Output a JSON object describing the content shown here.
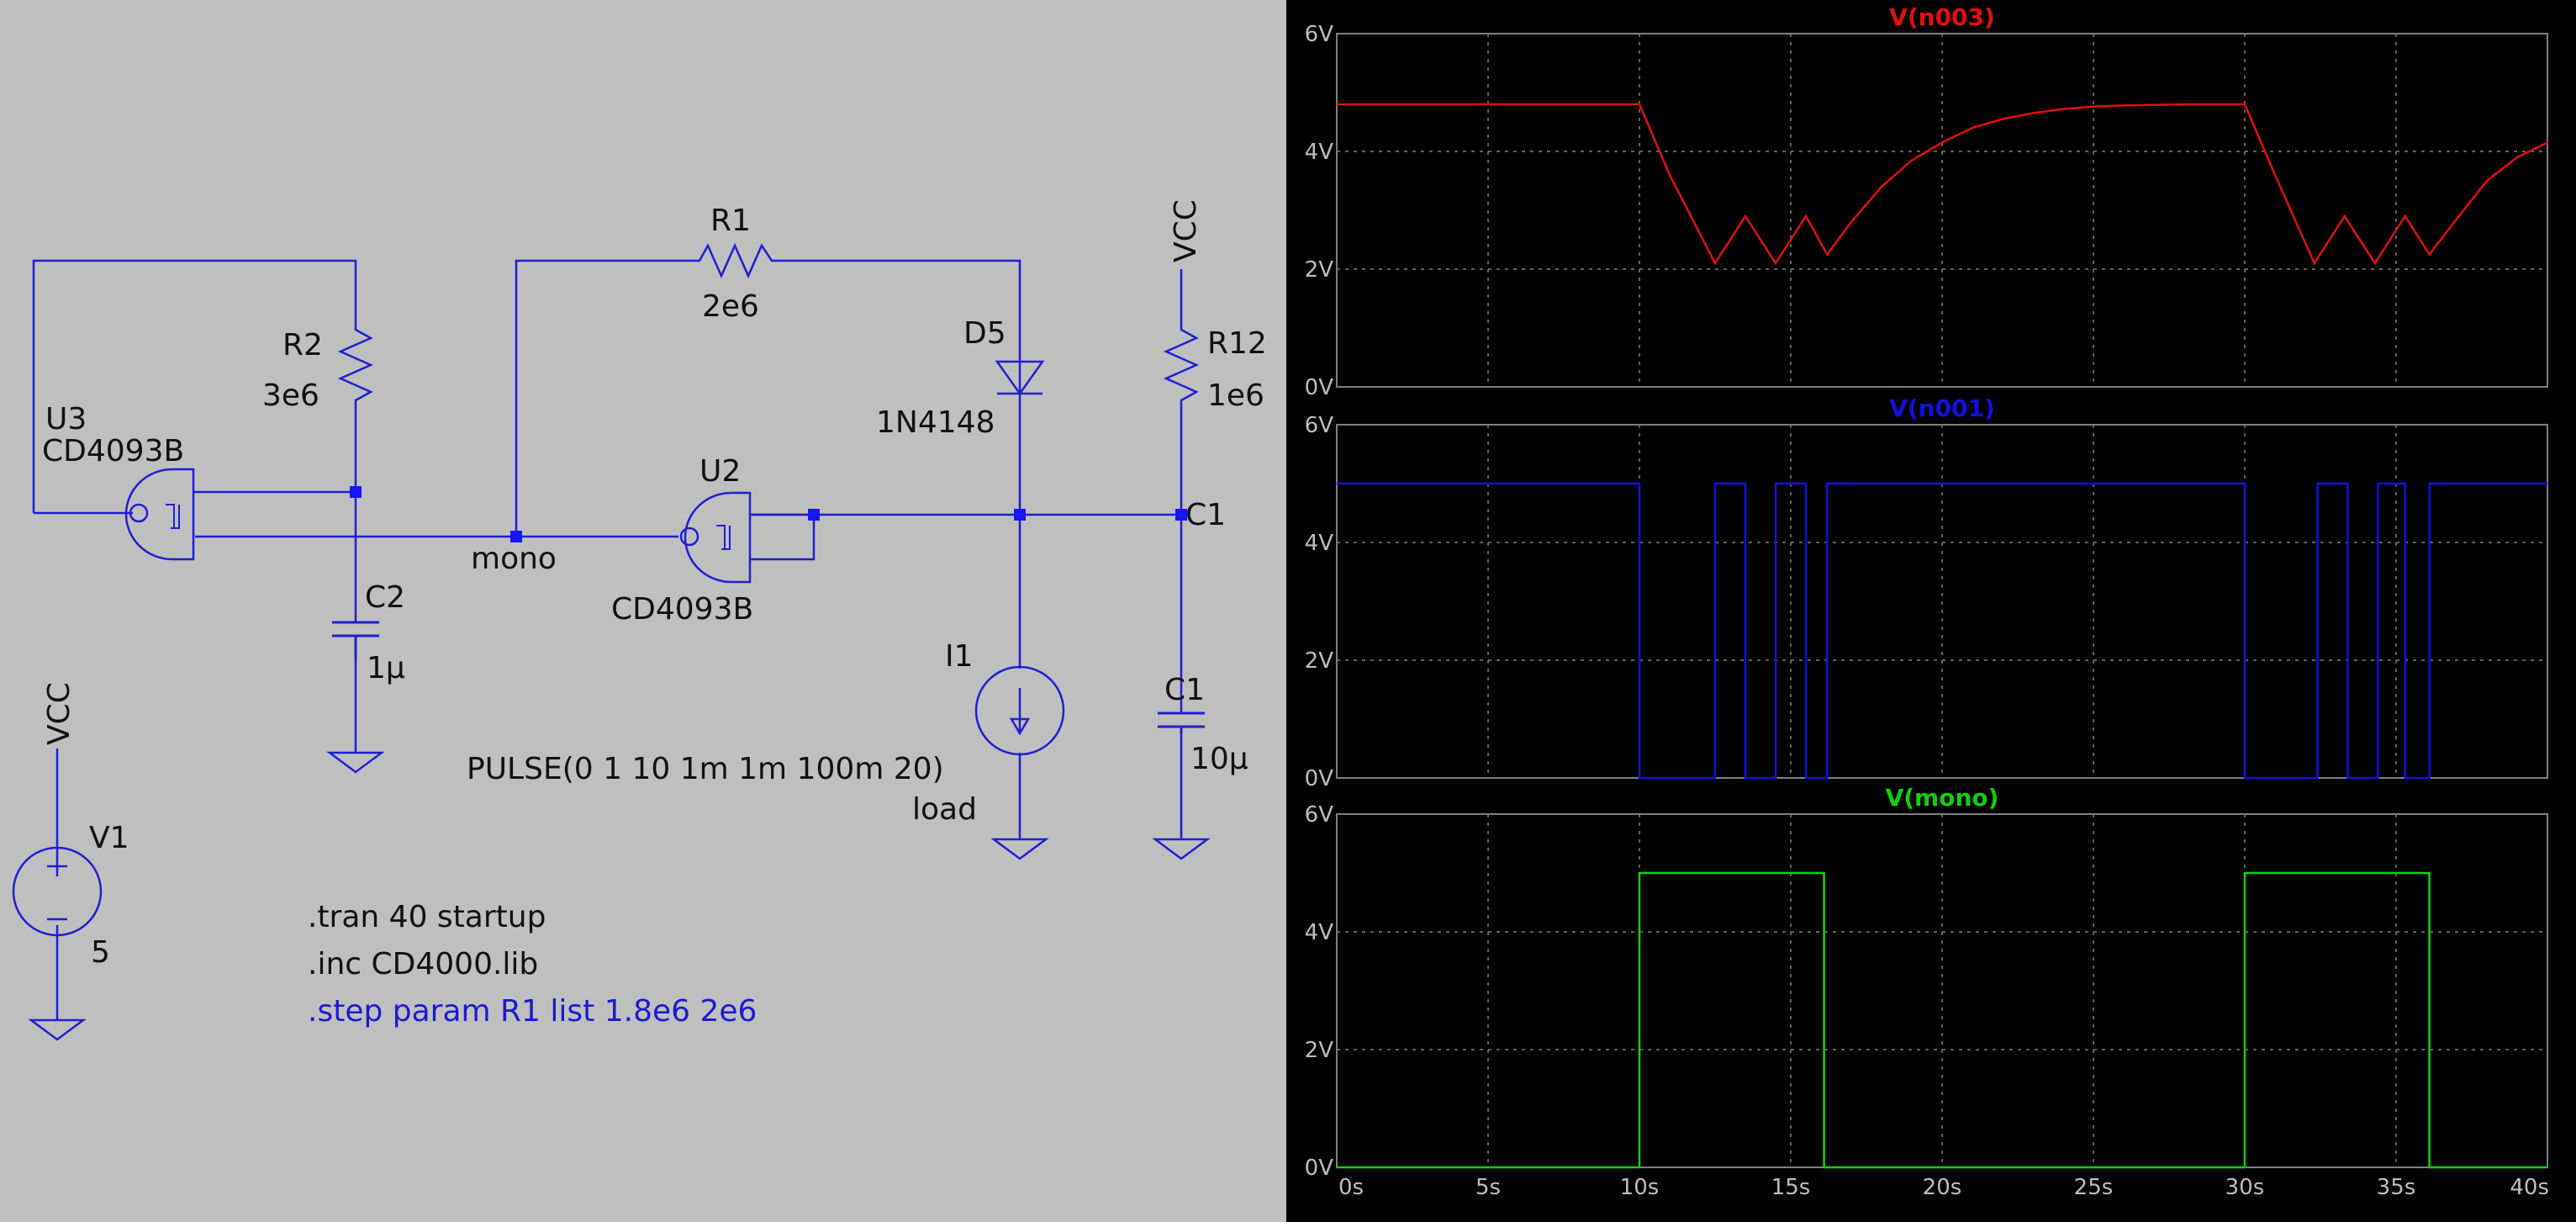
{
  "colors": {
    "schematic_bg": "#bfbfbf",
    "wire": "#1f1fd0",
    "node_dot": "#1515ff",
    "text": "#111111",
    "directive_active": "#1a1ad0",
    "plot_bg": "#000000",
    "grid": "#7f7f7f",
    "axis_text": "#bdbdbd",
    "trace_n003": "#e01010",
    "trace_n001": "#1010e0",
    "trace_mono": "#10d010"
  },
  "icons": {
    "nand_gate": "schmitt-nand-gate-icon",
    "resistor": "resistor-icon",
    "capacitor": "capacitor-icon",
    "diode": "diode-icon",
    "current_source": "current-source-icon",
    "voltage_source": "voltage-source-icon",
    "ground": "ground-icon"
  },
  "schematic": {
    "components": {
      "U3": {
        "ref": "U3",
        "model": "CD4093B"
      },
      "U2": {
        "ref": "U2",
        "model": "CD4093B"
      },
      "R1": {
        "ref": "R1",
        "value": "2e6"
      },
      "R2": {
        "ref": "R2",
        "value": "3e6"
      },
      "R12": {
        "ref": "R12",
        "value": "1e6"
      },
      "C1": {
        "ref": "C1",
        "value": "10µ"
      },
      "C2": {
        "ref": "C2",
        "value": "1µ"
      },
      "D5": {
        "ref": "D5",
        "value": "1N4148"
      },
      "I1": {
        "ref": "I1",
        "value": "PULSE(0 1 10 1m 1m 100m 20)",
        "label": "load"
      },
      "V1": {
        "ref": "V1",
        "value": "5"
      }
    },
    "nets": {
      "mono": "mono",
      "c1": "C1",
      "vcc_top": "VCC",
      "vcc_v1": "VCC"
    },
    "directives": {
      "tran": ".tran 40 startup",
      "inc": ".inc CD4000.lib",
      "step": ".step param R1 list 1.8e6 2e6"
    }
  },
  "chart_data": [
    {
      "type": "line",
      "title": "V(n003)",
      "x": [
        0,
        10,
        11,
        12.5,
        13.5,
        14.5,
        15.5,
        16.2,
        17,
        18,
        19,
        20,
        21,
        22,
        23,
        24,
        25,
        26,
        27,
        28,
        29,
        30,
        31,
        32.3,
        33.3,
        34.3,
        35.3,
        36.1,
        37,
        38,
        39,
        40
      ],
      "series": [
        {
          "values": [
            4.8,
            4.8,
            3.6,
            2.1,
            2.9,
            2.1,
            2.9,
            2.25,
            2.8,
            3.4,
            3.85,
            4.15,
            4.4,
            4.55,
            4.65,
            4.72,
            4.76,
            4.78,
            4.79,
            4.8,
            4.8,
            4.8,
            3.6,
            2.1,
            2.9,
            2.1,
            2.9,
            2.25,
            2.85,
            3.5,
            3.9,
            4.15
          ]
        }
      ],
      "xlim": [
        0,
        40
      ],
      "ylim": [
        0,
        6
      ],
      "x_ticks": [
        "0s",
        "5s",
        "10s",
        "15s",
        "20s",
        "25s",
        "30s",
        "35s",
        "40s"
      ],
      "y_ticks": [
        "0V",
        "2V",
        "4V",
        "6V"
      ],
      "grid": true
    },
    {
      "type": "line",
      "title": "V(n001)",
      "x": [
        0,
        10,
        10,
        12.5,
        12.5,
        13.5,
        13.5,
        14.5,
        14.5,
        15.5,
        15.5,
        16.2,
        16.2,
        30,
        30,
        32.4,
        32.4,
        33.4,
        33.4,
        34.4,
        34.4,
        35.3,
        35.3,
        36.1,
        36.1,
        40
      ],
      "series": [
        {
          "values": [
            5,
            5,
            0,
            0,
            5,
            5,
            0,
            0,
            5,
            5,
            0,
            0,
            5,
            5,
            0,
            0,
            5,
            5,
            0,
            0,
            5,
            5,
            0,
            0,
            5,
            5
          ]
        }
      ],
      "xlim": [
        0,
        40
      ],
      "ylim": [
        0,
        6
      ],
      "x_ticks": [
        "0s",
        "5s",
        "10s",
        "15s",
        "20s",
        "25s",
        "30s",
        "35s",
        "40s"
      ],
      "y_ticks": [
        "0V",
        "2V",
        "4V",
        "6V"
      ],
      "grid": true
    },
    {
      "type": "line",
      "title": "V(mono)",
      "x": [
        0,
        10,
        10,
        16.1,
        16.1,
        30,
        30,
        36.1,
        36.1,
        40
      ],
      "series": [
        {
          "values": [
            0,
            0,
            5,
            5,
            0,
            0,
            5,
            5,
            0,
            0
          ]
        }
      ],
      "xlim": [
        0,
        40
      ],
      "ylim": [
        0,
        6
      ],
      "x_ticks": [
        "0s",
        "5s",
        "10s",
        "15s",
        "20s",
        "25s",
        "30s",
        "35s",
        "40s"
      ],
      "y_ticks": [
        "0V",
        "2V",
        "4V",
        "6V"
      ],
      "grid": true
    }
  ]
}
